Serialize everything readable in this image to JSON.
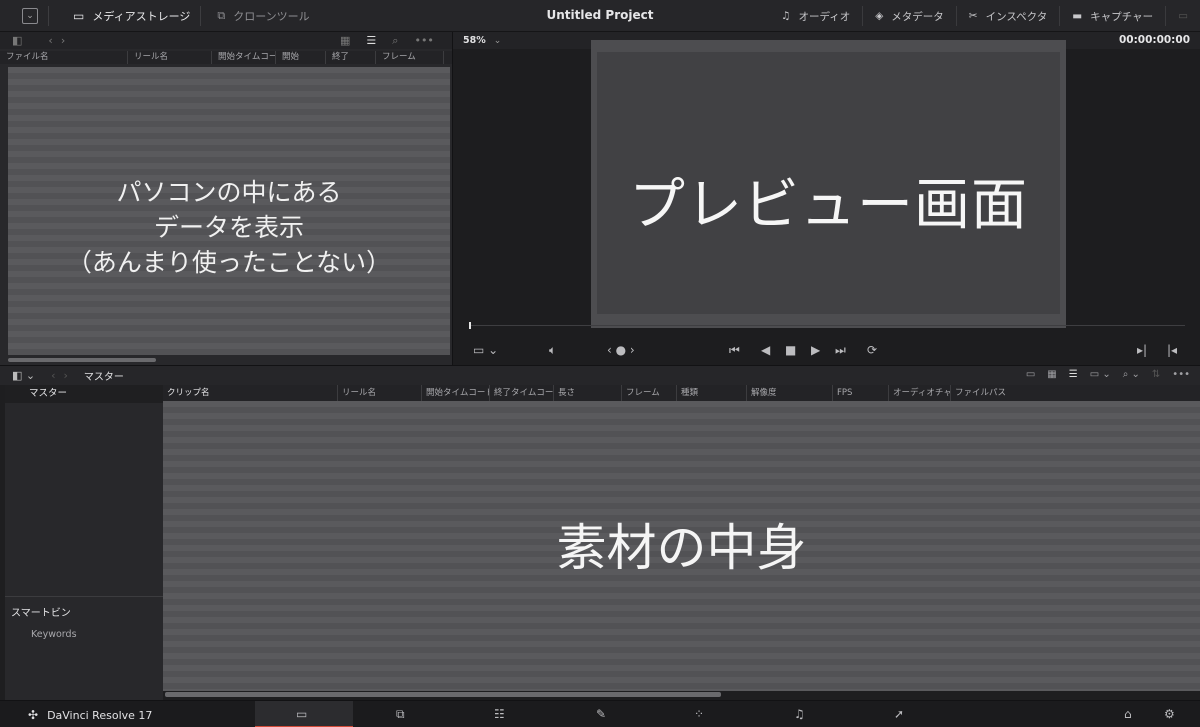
{
  "topbar": {
    "media_storage": "メディアストレージ",
    "clone_tool": "クローンツール",
    "project_title": "Untitled Project",
    "audio": "オーディオ",
    "metadata": "メタデータ",
    "inspector": "インスペクタ",
    "capture": "キャプチャー"
  },
  "storage_panel": {
    "columns": [
      "ファイル名",
      "リール名",
      "開始タイムコー",
      "開始",
      "終了",
      "フレーム"
    ],
    "note": [
      "パソコンの中にある",
      "データを表示",
      "（あんまり使ったことない）"
    ]
  },
  "viewer": {
    "zoom": "58%",
    "timecode": "00:00:00:00",
    "note": "プレビュー画面"
  },
  "media_pool": {
    "breadcrumb": "マスター",
    "bin_master": "マスター",
    "smart_bins": "スマートビン",
    "keywords": "Keywords",
    "columns": [
      "クリップ名",
      "リール名",
      "開始タイムコード",
      "終了タイムコード",
      "長さ",
      "フレーム",
      "種類",
      "解像度",
      "FPS",
      "オーディオチャ",
      "ファイルパス"
    ],
    "note": "素材の中身"
  },
  "bottombar": {
    "app_name": "DaVinci Resolve 17"
  },
  "colors": {
    "accent": "#d14b38"
  }
}
